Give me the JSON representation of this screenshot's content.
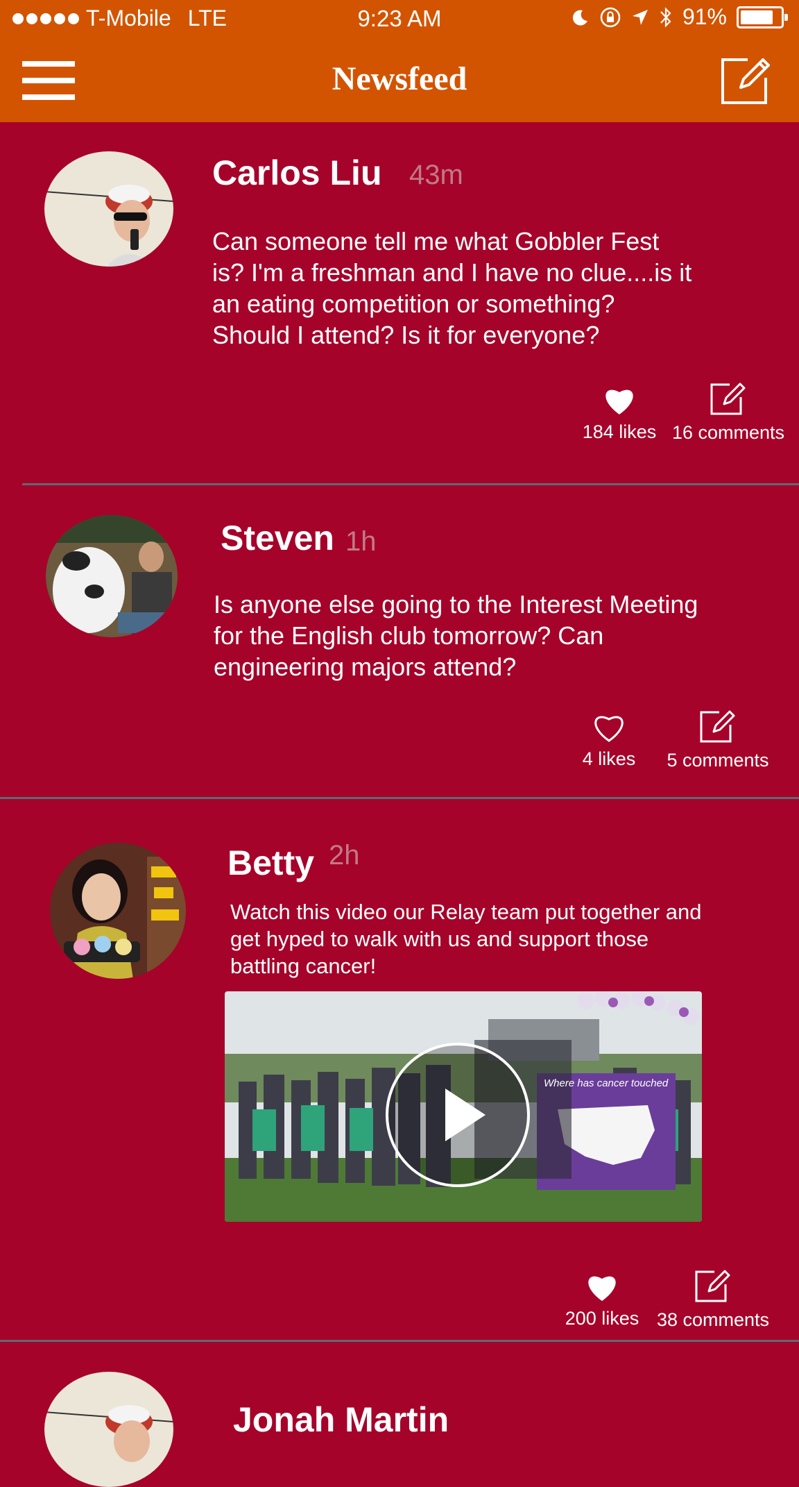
{
  "status_bar": {
    "carrier": "T-Mobile",
    "network": "LTE",
    "time": "9:23 AM",
    "battery": "91%",
    "battery_level": 0.91,
    "icons": [
      "moon-icon",
      "rotation-lock-icon",
      "location-arrow-icon",
      "bluetooth-icon",
      "battery-icon"
    ]
  },
  "nav": {
    "title": "Newsfeed",
    "left_icon": "hamburger-menu-icon",
    "right_icon": "compose-icon"
  },
  "colors": {
    "nav_background": "#d35400",
    "feed_background": "#a6032a",
    "timestamp": "#c17a85",
    "divider": "#5c6b75"
  },
  "posts": [
    {
      "author": "Carlos Liu",
      "time": "43m",
      "text": "Can someone tell me what Gobbler Fest is? I'm a freshman and I have no clue....is it an eating competition or something? Should I attend? Is it for everyone?",
      "likes": "184 likes",
      "comments": "16 comments",
      "liked": true
    },
    {
      "author": "Steven",
      "time": "1h",
      "text": "Is anyone else going to the Interest Meeting for the English club tomorrow? Can engineering majors attend?",
      "likes": "4 likes",
      "comments": "5 comments",
      "liked": false
    },
    {
      "author": "Betty",
      "time": "2h",
      "text": "Watch this video our Relay team put together and get hyped to walk with us and support those battling cancer!",
      "video_banner": "Where has cancer touched",
      "likes": "200 likes",
      "comments": "38 comments",
      "liked": true
    },
    {
      "author": "Jonah Martin"
    }
  ]
}
